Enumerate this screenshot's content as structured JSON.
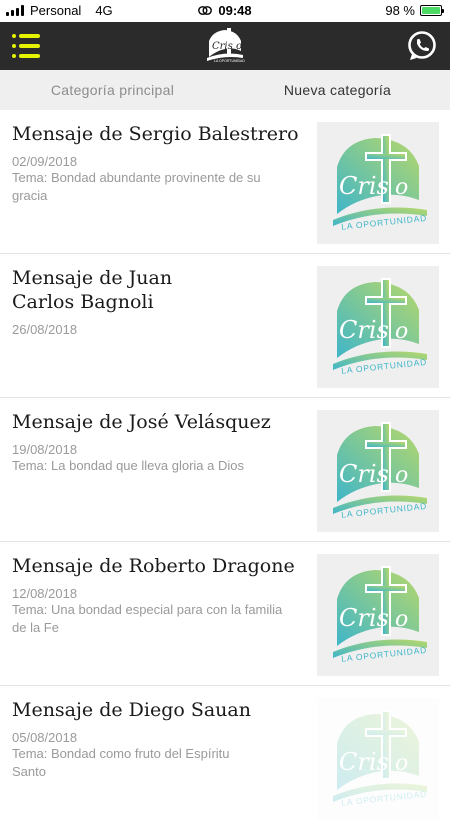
{
  "status_bar": {
    "carrier": "Personal",
    "network": "4G",
    "time": "09:48",
    "battery_text": "98 %",
    "battery_level": 0.98
  },
  "app_bar": {
    "logo_text": "Cris o",
    "logo_subtext": "LA OPORTUNIDAD"
  },
  "tabs": [
    {
      "label": "Categoría principal",
      "active": false
    },
    {
      "label": "Nueva categoría",
      "active": true
    }
  ],
  "messages": [
    {
      "title": "Mensaje de Sergio Balestrero",
      "date": "02/09/2018",
      "topic": "Tema: Bondad abundante provinente de su gracia"
    },
    {
      "title": "Mensaje de Juan Carlos Bagnoli",
      "date": "26/08/2018",
      "topic": ""
    },
    {
      "title": "Mensaje de José Velásquez",
      "date": "19/08/2018",
      "topic": "Tema: La bondad que lleva gloria a Dios"
    },
    {
      "title": "Mensaje de Roberto Dragone",
      "date": "12/08/2018",
      "topic": "Tema: Una bondad especial para con la familia de la Fe"
    },
    {
      "title": "Mensaje de Diego Sauan",
      "date": "05/08/2018",
      "topic": "Tema: Bondad como fruto del Espíritu Santo"
    }
  ],
  "thumbnail": {
    "word": "Cris",
    "word_end": "o",
    "tagline": "LA OPORTUNIDAD",
    "gradient_start": "#3fb6c9",
    "gradient_end": "#b7d86a"
  },
  "colors": {
    "app_bar": "#2b2b2b",
    "menu_icon": "#e5f200",
    "tabs_bg": "#efefef"
  },
  "icons": {
    "menu": "hamburger-menu-icon",
    "whatsapp": "whatsapp-icon",
    "signal": "cell-signal-icon",
    "link": "link-icon",
    "battery": "battery-icon"
  }
}
